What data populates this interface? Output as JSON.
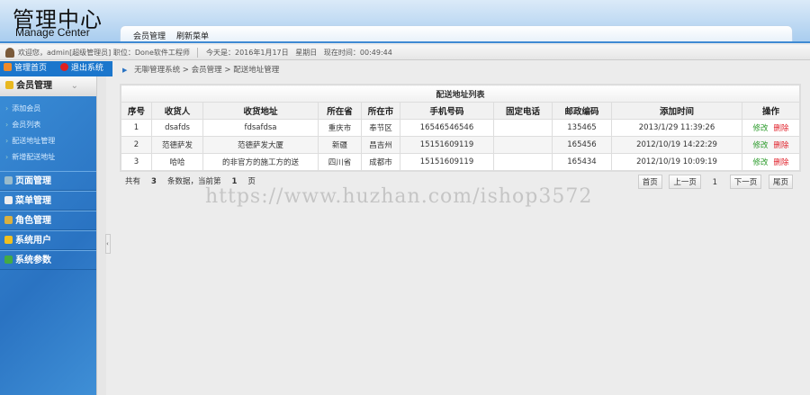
{
  "header": {
    "logo_cn": "管理中心",
    "logo_en": "Manage Center",
    "nav": [
      "会员管理",
      "刷新菜单"
    ]
  },
  "infobar": {
    "welcome": "欢迎您，admin[超级管理员] 职位：Done软件工程师",
    "date": "今天是：2016年1月17日",
    "weekday": "星期日",
    "time": "现在时间：00:49:44"
  },
  "sidebar": {
    "home": "管理首页",
    "logout": "退出系统",
    "open_group": "会员管理",
    "sub_items": [
      "添加会员",
      "会员列表",
      "配送地址管理",
      "新增配送地址"
    ],
    "groups": [
      "页面管理",
      "菜单管理",
      "角色管理",
      "系统用户",
      "系统参数"
    ]
  },
  "breadcrumb": [
    "无聊管理系统",
    "会员管理",
    "配送地址管理"
  ],
  "table": {
    "title": "配送地址列表",
    "columns": [
      "序号",
      "收货人",
      "收货地址",
      "所在省",
      "所在市",
      "手机号码",
      "固定电话",
      "邮政编码",
      "添加时间",
      "操作"
    ],
    "rows": [
      [
        "1",
        "dsafds",
        "fdsafdsa",
        "重庆市",
        "奉节区",
        "16546546546",
        "",
        "135465",
        "2013/1/29 11:39:26"
      ],
      [
        "2",
        "范德萨发",
        "范德萨发大厦",
        "新疆",
        "昌吉州",
        "15151609119",
        "",
        "165456",
        "2012/10/19 14:22:29"
      ],
      [
        "3",
        "哈哈",
        "的非官方的施工方的送",
        "四川省",
        "成都市",
        "15151609119",
        "",
        "165434",
        "2012/10/19 10:09:19"
      ]
    ],
    "edit_label": "修改",
    "delete_label": "删除"
  },
  "footer": {
    "prefix": "共有",
    "count": "3",
    "mid": "条数据，当前第",
    "page": "1",
    "suffix": "页"
  },
  "pager": {
    "first": "首页",
    "prev": "上一页",
    "current": "1",
    "next": "下一页",
    "last": "尾页"
  },
  "watermark": "https://www.huzhan.com/ishop3572"
}
